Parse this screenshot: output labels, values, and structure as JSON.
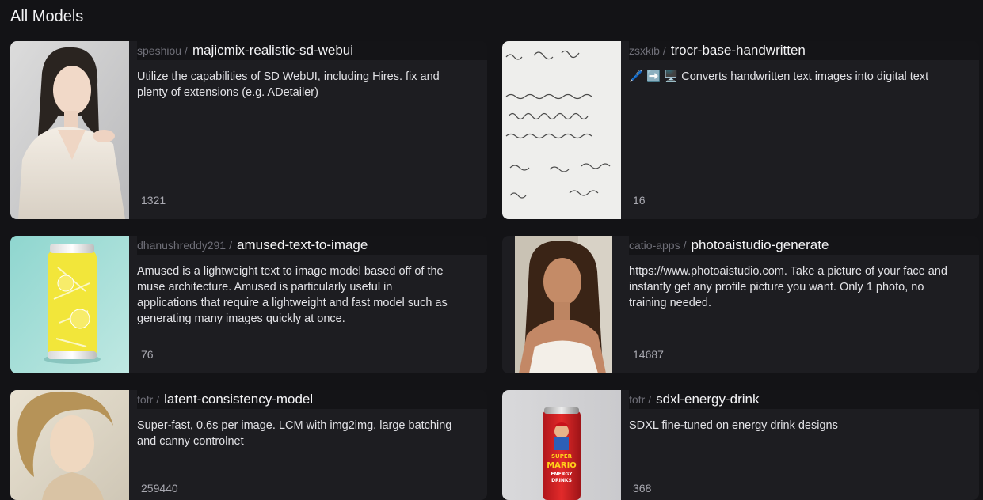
{
  "page": {
    "title": "All Models"
  },
  "models": [
    {
      "owner": "speshiou",
      "slash": "/",
      "name": "majicmix-realistic-sd-webui",
      "description": "Utilize the capabilities of SD WebUI, including Hires. fix and plenty of extensions (e.g. ADetailer)",
      "runs": "1321",
      "thumb": "portrait-woman-sweater"
    },
    {
      "owner": "zsxkib",
      "slash": "/",
      "name": "trocr-base-handwritten",
      "description": "🖊️ ➡️ 🖥️ Converts handwritten text images into digital text",
      "runs": "16",
      "thumb": "handwriting-scan"
    },
    {
      "owner": "dhanushreddy291",
      "slash": "/",
      "name": "amused-text-to-image",
      "description": "Amused is a lightweight text to image model based off of the muse architecture. Amused is particularly useful in applications that require a lightweight and fast model such as generating many images quickly at once.",
      "runs": "76",
      "thumb": "lemon-can"
    },
    {
      "owner": "catio-apps",
      "slash": "/",
      "name": "photoaistudio-generate",
      "description": "https://www.photoaistudio.com. Take a picture of your face and instantly get any profile picture you want. Only 1 photo, no training needed.",
      "runs": "14687",
      "thumb": "portrait-woman-smiling"
    },
    {
      "owner": "fofr",
      "slash": "/",
      "name": "latent-consistency-model",
      "description": "Super-fast, 0.6s per image. LCM with img2img, large batching and canny controlnet",
      "runs": "259440",
      "thumb": "painted-portrait"
    },
    {
      "owner": "fofr",
      "slash": "/",
      "name": "sdxl-energy-drink",
      "description": "SDXL fine-tuned on energy drink designs",
      "runs": "368",
      "thumb": "energy-drink-can",
      "can_text": [
        "SUPER",
        "MARIO",
        "ENERGY",
        "DRINKS"
      ]
    }
  ]
}
